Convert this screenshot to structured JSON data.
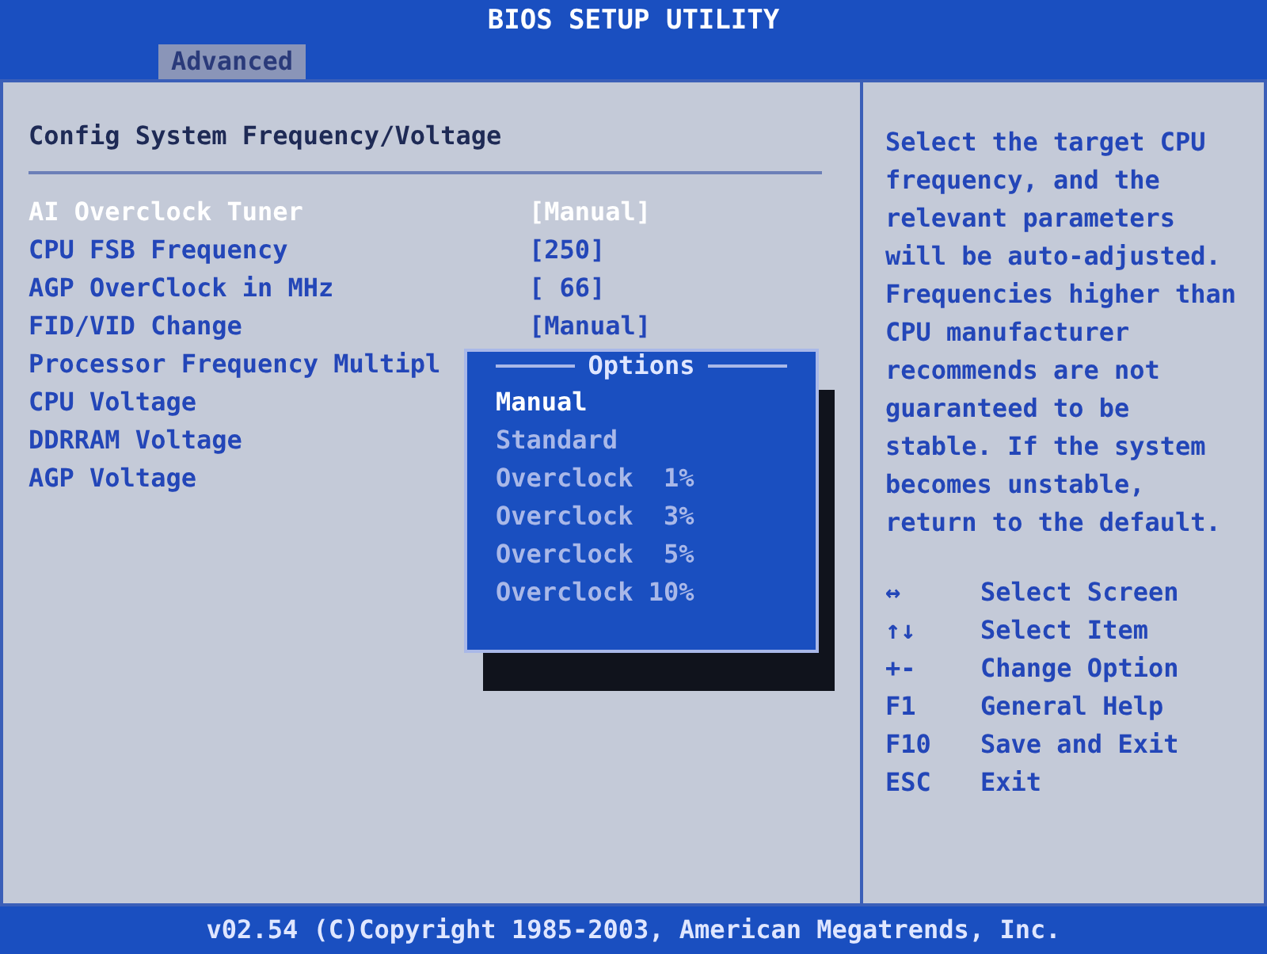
{
  "window": {
    "title": "BIOS SETUP UTILITY"
  },
  "tabs": [
    {
      "label": "Advanced",
      "selected": true
    }
  ],
  "section_title": "Config System Frequency/Voltage",
  "settings": [
    {
      "label": "AI Overclock Tuner",
      "value": "[Manual]",
      "selected": true
    },
    {
      "label": "CPU FSB Frequency",
      "value": "[250]",
      "selected": false
    },
    {
      "label": "AGP OverClock in MHz",
      "value": "[ 66]",
      "selected": false
    },
    {
      "label": "FID/VID Change",
      "value": "[Manual]",
      "selected": false
    },
    {
      "label": "Processor Frequency Multipl",
      "selected": false
    },
    {
      "label": "CPU Voltage",
      "selected": false
    },
    {
      "label": "DDRRAM Voltage",
      "selected": false
    },
    {
      "label": "AGP Voltage",
      "selected": false
    }
  ],
  "options_popup": {
    "title": "Options",
    "options": [
      {
        "label": "Manual",
        "selected": true
      },
      {
        "label": "Standard",
        "selected": false
      },
      {
        "label": "Overclock  1%",
        "selected": false
      },
      {
        "label": "Overclock  3%",
        "selected": false
      },
      {
        "label": "Overclock  5%",
        "selected": false
      },
      {
        "label": "Overclock 10%",
        "selected": false
      }
    ]
  },
  "help_text": "Select the target CPU frequency, and the relevant parameters will be auto-adjusted. Frequencies higher than CPU manufacturer recommends are not guaranteed to be stable. If the system becomes unstable, return to the default.",
  "keys": [
    {
      "key": "↔",
      "action": "Select Screen"
    },
    {
      "key": "↑↓",
      "action": "Select Item"
    },
    {
      "key": "+-",
      "action": "Change Option"
    },
    {
      "key": "F1",
      "action": "General Help"
    },
    {
      "key": "F10",
      "action": "Save and Exit"
    },
    {
      "key": "ESC",
      "action": "Exit"
    }
  ],
  "status_bar": "v02.54 (C)Copyright 1985-2003, American Megatrends, Inc."
}
